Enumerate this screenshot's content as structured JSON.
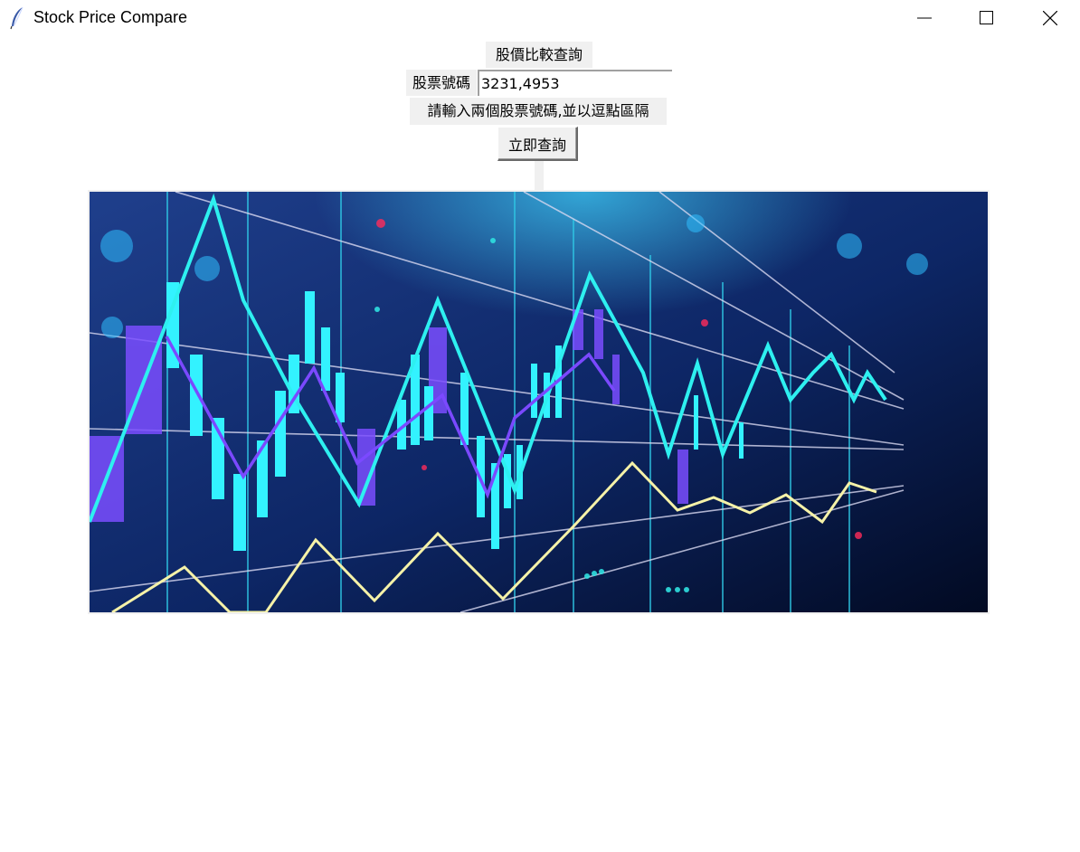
{
  "window": {
    "title": "Stock Price Compare",
    "app_icon": "feather-icon",
    "controls": [
      "minimize-icon",
      "maximize-icon",
      "close-icon"
    ]
  },
  "form": {
    "heading": "股價比較查詢",
    "input_label": "股票號碼",
    "input_value": "3231,4953",
    "hint": "請輸入兩個股票號碼,並以逗點區隔",
    "submit_label": "立即查詢"
  },
  "banner_image": {
    "description_icon": "stock-chart-banner",
    "colors": {
      "background_top": "#1e3f8a",
      "background_bottom": "#03112e",
      "cyan": "#2ef0f0",
      "purple": "#7a4dff",
      "yellow": "#f6f2a8"
    }
  }
}
